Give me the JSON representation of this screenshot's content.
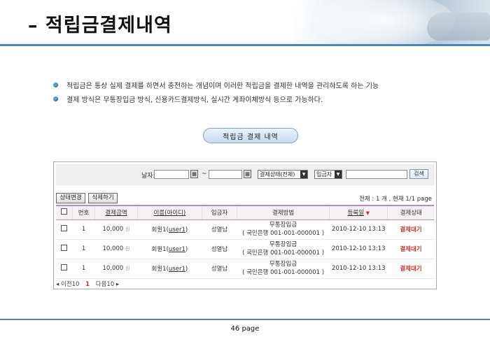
{
  "header": {
    "title": "– 적립금결제내역"
  },
  "bullets": [
    "적립금은 통상 실제 결제를 하면서 충전하는 개념이며 이러한 적립금을 결제한 내역을 관리하도록 하는 기능",
    "결제 방식은 무통장입금 방식, 신용카드결제방식, 실시간 계좌이체방식 등으로 가능하다."
  ],
  "section_title": "적립금 결제 내역",
  "search": {
    "date_label": "날자:",
    "tilde": "~",
    "date_from": "",
    "date_to": "",
    "calendar_icon": "▦",
    "status_select": "결제상태(전체)",
    "type_select": "입금자",
    "keyword": "",
    "search_button": "검색"
  },
  "actions": {
    "change_status": "상태변경",
    "delete": "삭제하기"
  },
  "summary": "전체 : 1 개 ,  현재 1/1 page",
  "table": {
    "headers": [
      "",
      "번호",
      "결제금액",
      "이름(아이디)",
      "입금자",
      "결제방법",
      "등록일",
      "결제상태"
    ],
    "sort_indicator": "▼",
    "rows": [
      {
        "no": "1",
        "amount": "10,000",
        "unit": "원",
        "name": "회원1(",
        "id": "user1",
        "close": ")",
        "depositor": "성열남",
        "method": "무통장입금",
        "account": "( 국민은행 001-001-000001 )",
        "date": "2010-12-10 13:13",
        "status": "결제대기"
      },
      {
        "no": "1",
        "amount": "10,000",
        "unit": "원",
        "name": "회원1(",
        "id": "user1",
        "close": ")",
        "depositor": "성열남",
        "method": "무통장입금",
        "account": "( 국민은행 001-001-000001 )",
        "date": "2010-12-10 13:13",
        "status": "결제대기"
      },
      {
        "no": "1",
        "amount": "10,000",
        "unit": "원",
        "name": "회원1(",
        "id": "user1",
        "close": ")",
        "depositor": "성열남",
        "method": "무통장입금",
        "account": "( 국민은행 001-001-000001 )",
        "date": "2010-12-10 13:13",
        "status": "결제대기"
      }
    ]
  },
  "pager": {
    "prev": "◂ 이전10",
    "current": "1",
    "next": "다음10 ▸"
  },
  "footer": {
    "page": "46 page"
  },
  "colors": {
    "accent": "#4a86b8",
    "status": "#c7332b",
    "header_line": "#b48cc4"
  }
}
